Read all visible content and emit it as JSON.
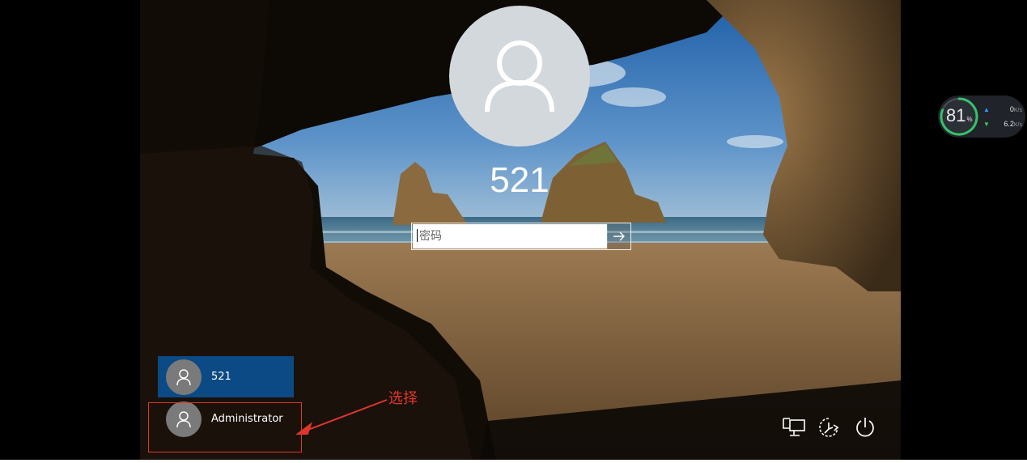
{
  "user": {
    "display_name": "521"
  },
  "password": {
    "placeholder": "密码",
    "value": ""
  },
  "user_list": [
    {
      "name": "521",
      "selected": true
    },
    {
      "name": "Administrator",
      "selected": false
    }
  ],
  "annotation": {
    "label": "选择",
    "color": "#e0372b"
  },
  "network_monitor": {
    "percent": "81",
    "percent_unit": "%",
    "upload": "0",
    "upload_unit": "K/s",
    "download": "6.2",
    "download_unit": "K/s",
    "level": 0.81
  },
  "system_icons": [
    "network-icon",
    "accessibility-icon",
    "power-icon"
  ],
  "colors": {
    "selected_user_bg": "#0b4a84",
    "avatar_bg": "#d3d8dc",
    "annotation": "#e0372b"
  }
}
